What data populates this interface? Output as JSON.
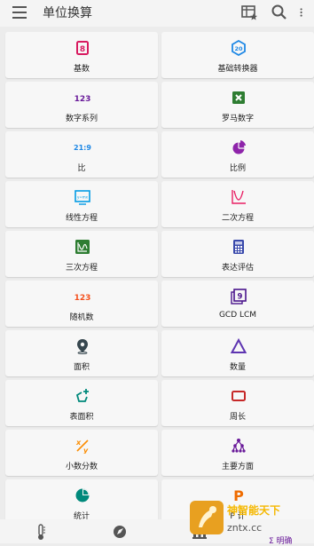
{
  "header": {
    "title": "单位换算"
  },
  "cards": [
    {
      "label": "基数",
      "icon": "base-8-icon",
      "color": "#d81b60"
    },
    {
      "label": "基础转换器",
      "icon": "base-20-converter-icon",
      "color": "#1e88e5"
    },
    {
      "label": "数字系列",
      "icon": "123-series-icon",
      "color": "#6a1b9a"
    },
    {
      "label": "罗马数字",
      "icon": "roman-x-icon",
      "color": "#2e7d32"
    },
    {
      "label": "比",
      "icon": "ratio-icon",
      "color": "#1e88e5"
    },
    {
      "label": "比例",
      "icon": "pie-proportion-icon",
      "color": "#8e24aa"
    },
    {
      "label": "线性方程",
      "icon": "linear-equation-icon",
      "color": "#039be5"
    },
    {
      "label": "二次方程",
      "icon": "quadratic-curve-icon",
      "color": "#e91e63"
    },
    {
      "label": "三次方程",
      "icon": "cubic-graph-icon",
      "color": "#2e7d32"
    },
    {
      "label": "表达评估",
      "icon": "calculator-icon",
      "color": "#3949ab"
    },
    {
      "label": "随机数",
      "icon": "random-123-icon",
      "color": "#f4511e"
    },
    {
      "label": "GCD LCM",
      "icon": "gcd-9-icon",
      "color": "#4a148c"
    },
    {
      "label": "面积",
      "icon": "area-pin-icon",
      "color": "#37474f"
    },
    {
      "label": "数量",
      "icon": "triangle-volume-icon",
      "color": "#5e35b1"
    },
    {
      "label": "表面积",
      "icon": "surface-area-icon",
      "color": "#00897b"
    },
    {
      "label": "周长",
      "icon": "rectangle-perimeter-icon",
      "color": "#c62828"
    },
    {
      "label": "小数分数",
      "icon": "fraction-xy-icon",
      "color": "#fb8c00"
    },
    {
      "label": "主要方面",
      "icon": "tree-factors-icon",
      "color": "#6a1b9a"
    },
    {
      "label": "统计",
      "icon": "statistics-pie-icon",
      "color": "#00897b"
    },
    {
      "label": "P 计",
      "icon": "permutation-p-icon",
      "color": "#ef6c00"
    }
  ],
  "card_icon_text": {
    "base": "8",
    "base_conv": "20",
    "series": "123",
    "ratio": "21:9",
    "random": "123",
    "gcd": "9",
    "linear": "y=mx",
    "perm": "P"
  },
  "bottom": {
    "tab_active_label": "Σ 明确"
  },
  "watermark": {
    "text": "神智能天下",
    "url": "zntx.cc"
  },
  "accent": "#6a1b9a"
}
